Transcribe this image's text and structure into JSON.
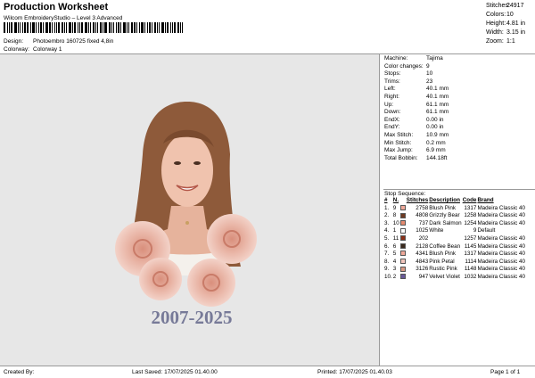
{
  "header": {
    "title": "Production Worksheet",
    "subtitle": "Wilcom EmbroideryStudio – Level 3 Advanced"
  },
  "stats": [
    {
      "label": "Stitches:",
      "value": "24917"
    },
    {
      "label": "Colors:",
      "value": "10"
    },
    {
      "label": "Height:",
      "value": "4.81 in"
    },
    {
      "label": "Width:",
      "value": "3.15 in"
    },
    {
      "label": "Zoom:",
      "value": "1:1"
    }
  ],
  "meta": [
    {
      "label": "Design:",
      "value": "Photoembro 160725 fixed 4,8in"
    },
    {
      "label": "Colorway:",
      "value": "Colorway 1"
    }
  ],
  "design": {
    "year_text": "2007-2025"
  },
  "machine_info": [
    {
      "label": "Machine:",
      "value": "Tajima"
    },
    {
      "label": "Color changes:",
      "value": "9"
    },
    {
      "label": "Stops:",
      "value": "10"
    },
    {
      "label": "Trims:",
      "value": "23"
    },
    {
      "label": "Left:",
      "value": "40.1 mm"
    },
    {
      "label": "Right:",
      "value": "40.1 mm"
    },
    {
      "label": "Up:",
      "value": "61.1 mm"
    },
    {
      "label": "Down:",
      "value": "61.1 mm"
    },
    {
      "label": "EndX:",
      "value": "0.00 in"
    },
    {
      "label": "EndY:",
      "value": "0.00 in"
    },
    {
      "label": "Max Stitch:",
      "value": "10.9 mm"
    },
    {
      "label": "Min Stitch:",
      "value": "0.2 mm"
    },
    {
      "label": "Max Jump:",
      "value": "6.9 mm"
    },
    {
      "label": "Total Bobbin:",
      "value": "144.18ft"
    }
  ],
  "stop_sequence": {
    "title": "Stop Sequence:",
    "headers": [
      "#",
      "N.",
      "",
      "Stitches",
      "Description",
      "Code",
      "Brand"
    ],
    "rows": [
      {
        "stop": "1.",
        "n": "9",
        "color": "#f0a99a",
        "stitches": "2758",
        "desc": "Blush Pink",
        "code": "1317",
        "brand": "Madeira Classic 40"
      },
      {
        "stop": "2.",
        "n": "8",
        "color": "#6e3a22",
        "stitches": "4808",
        "desc": "Grizzly Bear",
        "code": "1258",
        "brand": "Madeira Classic 40"
      },
      {
        "stop": "3.",
        "n": "10",
        "color": "#e58a6f",
        "stitches": "737",
        "desc": "Dark Salmon",
        "code": "1254",
        "brand": "Madeira Classic 40"
      },
      {
        "stop": "4.",
        "n": "1",
        "color": "#ffffff",
        "stitches": "1025",
        "desc": "White",
        "code": "9",
        "brand": "Default"
      },
      {
        "stop": "5.",
        "n": "11",
        "color": "#8b2f17",
        "stitches": "202",
        "desc": "",
        "code": "1257",
        "brand": "Madeira Classic 40"
      },
      {
        "stop": "6.",
        "n": "6",
        "color": "#3b2a1e",
        "stitches": "2128",
        "desc": "Coffee Bean",
        "code": "1145",
        "brand": "Madeira Classic 40"
      },
      {
        "stop": "7.",
        "n": "5",
        "color": "#f0a99a",
        "stitches": "4341",
        "desc": "Blush Pink",
        "code": "1317",
        "brand": "Madeira Classic 40"
      },
      {
        "stop": "8.",
        "n": "4",
        "color": "#f2c6bd",
        "stitches": "4843",
        "desc": "Pink Petal",
        "code": "1114",
        "brand": "Madeira Classic 40"
      },
      {
        "stop": "9.",
        "n": "3",
        "color": "#d99a84",
        "stitches": "3126",
        "desc": "Rustic Pink",
        "code": "1148",
        "brand": "Madeira Classic 40"
      },
      {
        "stop": "10.",
        "n": "2",
        "color": "#6a5a9a",
        "stitches": "947",
        "desc": "Velvet Violet",
        "code": "1032",
        "brand": "Madeira Classic 40"
      }
    ]
  },
  "footer": {
    "created_by": "Created By:",
    "last_saved": "Last Saved: 17/07/2025 01.40.00",
    "printed": "Printed: 17/07/2025 01.40.03",
    "page": "Page 1 of 1"
  }
}
